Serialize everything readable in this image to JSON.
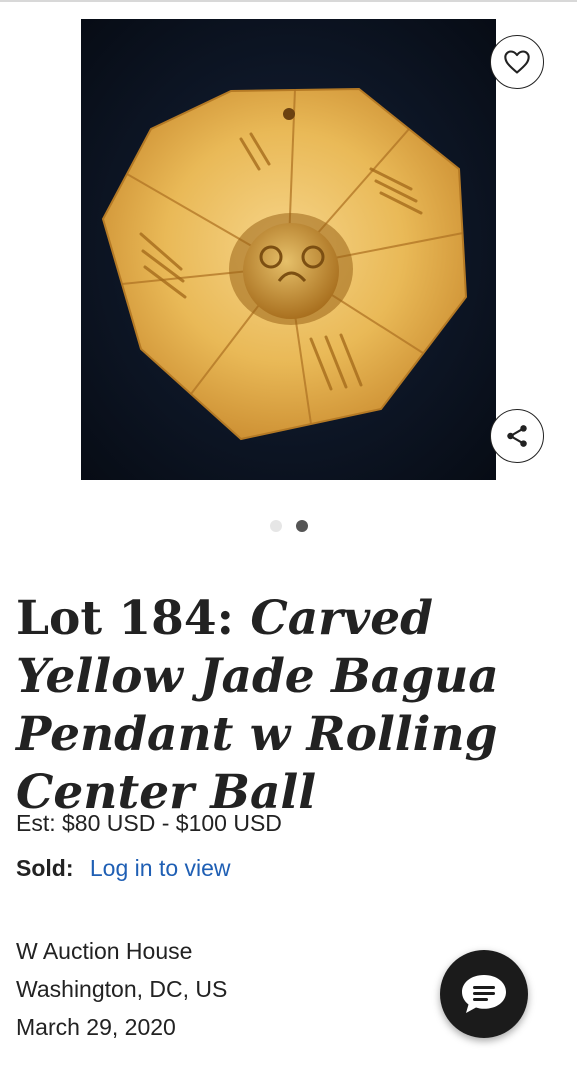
{
  "lot": {
    "number_label": "Lot 184:",
    "name": "Carved Yellow Jade Bagua Pendant w Rolling Center Ball",
    "image_alt": "carved yellow jade octagonal bagua pendant",
    "carousel": {
      "count": 2,
      "active_index": 1
    }
  },
  "pricing": {
    "estimate": "Est: $80 USD - $100 USD",
    "sold_label": "Sold:",
    "sold_link": "Log in to view"
  },
  "house": {
    "name": "W Auction House",
    "location": "Washington, DC, US",
    "date": "March 29, 2020"
  },
  "icons": {
    "favorite": "heart-icon",
    "share": "share-icon",
    "chat": "chat-icon"
  },
  "colors": {
    "link": "#1f5fb4",
    "chat_button": "#1b1b1b",
    "jade": "#e8b858"
  }
}
